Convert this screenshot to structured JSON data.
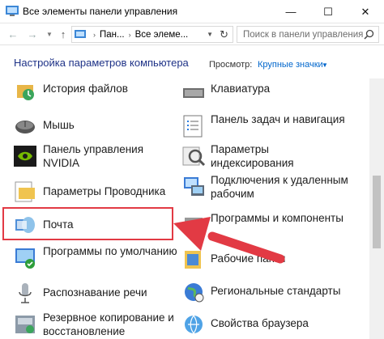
{
  "window": {
    "title": "Все элементы панели управления",
    "minimize_icon": "minimize-icon",
    "maximize_icon": "maximize-icon",
    "close_icon": "close-icon"
  },
  "address": {
    "crumbs": [
      "Пан...",
      "Все элеме..."
    ],
    "search_placeholder": "Поиск в панели управления"
  },
  "header": {
    "title": "Настройка параметров компьютера",
    "view_label": "Просмотр:",
    "view_value": "Крупные значки"
  },
  "items_left": [
    {
      "label": "История файлов",
      "icon": "file-history-icon"
    },
    {
      "label": "Мышь",
      "icon": "mouse-icon"
    },
    {
      "label": "Панель управления NVIDIA",
      "icon": "nvidia-icon"
    },
    {
      "label": "Параметры Проводника",
      "icon": "folder-options-icon"
    },
    {
      "label": "Почта",
      "icon": "mail-icon"
    },
    {
      "label": "Программы по умолчанию",
      "icon": "default-programs-icon"
    },
    {
      "label": "Распознавание речи",
      "icon": "microphone-icon"
    },
    {
      "label": "Резервное копирование и восстановление",
      "icon": "backup-icon"
    }
  ],
  "items_right": [
    {
      "label": "Клавиатура",
      "icon": "keyboard-icon"
    },
    {
      "label": "Панель задач и навигация",
      "icon": "taskbar-icon"
    },
    {
      "label": "Параметры индексирования",
      "icon": "indexing-icon"
    },
    {
      "label": "Подключения к удаленным рабочим",
      "icon": "remote-desktop-icon"
    },
    {
      "label": "Программы и компоненты",
      "icon": "programs-icon"
    },
    {
      "label": "Рабочие папки",
      "icon": "work-folders-icon"
    },
    {
      "label": "Региональные стандарты",
      "icon": "region-icon"
    },
    {
      "label": "Свойства браузера",
      "icon": "browser-properties-icon"
    }
  ],
  "colors": {
    "highlight": "#e23a44",
    "link": "#0066cc",
    "heading": "#1e3287"
  }
}
